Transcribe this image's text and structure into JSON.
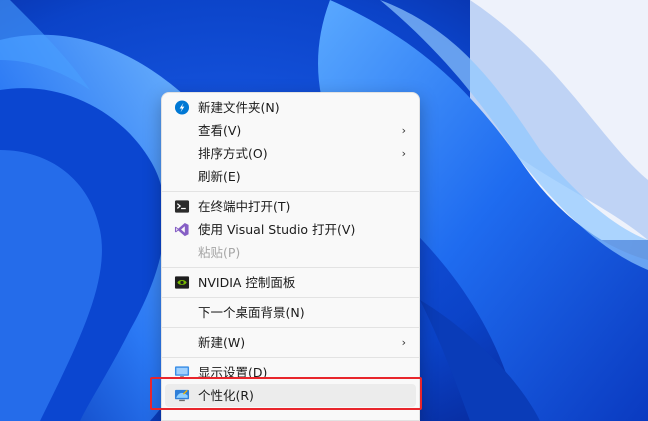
{
  "menu": {
    "new_folder": "新建文件夹(N)",
    "view": "查看(V)",
    "sort_by": "排序方式(O)",
    "refresh": "刷新(E)",
    "open_terminal": "在终端中打开(T)",
    "open_vs": "使用 Visual Studio 打开(V)",
    "paste": "粘贴(P)",
    "nvidia": "NVIDIA 控制面板",
    "next_background": "下一个桌面背景(N)",
    "new": "新建(W)",
    "display_settings": "显示设置(D)",
    "personalize": "个性化(R)"
  },
  "colors": {
    "highlight": "#e8262c",
    "accent": "#0067c0"
  }
}
